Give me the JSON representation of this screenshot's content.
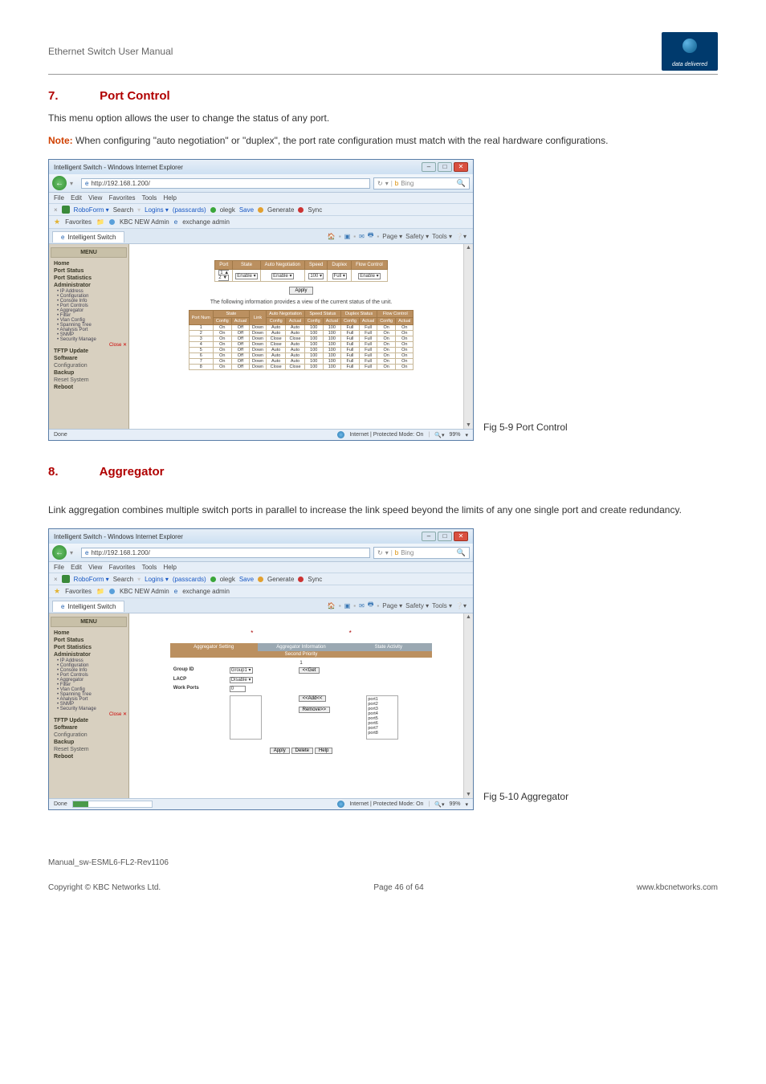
{
  "header": {
    "manual_title": "Ethernet Switch User Manual",
    "logo_text": "data delivered"
  },
  "section7": {
    "num": "7.",
    "title": "Port Control",
    "intro": "This menu option allows the user to change the status of any port.",
    "note_label": "Note:",
    "note_body": " When configuring \"auto negotiation\" or \"duplex\", the port rate configuration must match with the real hardware configurations.",
    "caption": "Fig 5-9 Port Control"
  },
  "section8": {
    "num": "8.",
    "title": "Aggregator",
    "intro": "Link aggregation combines multiple switch ports in parallel to increase the link speed beyond the limits of any one single port and create redundancy.",
    "caption": "Fig 5-10 Aggregator"
  },
  "browser": {
    "title": "Intelligent Switch - Windows Internet Explorer",
    "url": "http://192.168.1.200/",
    "search_placeholder": "Bing",
    "menus": {
      "file": "File",
      "edit": "Edit",
      "view": "View",
      "favorites": "Favorites",
      "tools": "Tools",
      "help": "Help"
    },
    "toolbar": {
      "roboform": "RoboForm ▾",
      "search_label": "Search",
      "logins": "Logins ▾",
      "passcards": "(passcards)",
      "olegk": "olegk",
      "save": "Save",
      "generate": "Generate",
      "sync": "Sync"
    },
    "favbar": {
      "favorites": "Favorites",
      "kbc": "KBC NEW Admin",
      "exchange": "exchange admin"
    },
    "tab": "Intelligent Switch",
    "tab_tools": {
      "home": "🏠",
      "feed": "▾",
      "mail": "▾",
      "print": "▾",
      "page": "Page ▾",
      "safety": "Safety ▾",
      "tools": "Tools ▾",
      "help": "❔▾"
    },
    "status_done": "Done",
    "status_mode": "Internet | Protected Mode: On",
    "status_zoom": "99%"
  },
  "menu_panel": {
    "header": "MENU",
    "items_top": [
      "Home",
      "Port Status",
      "Port Statistics",
      "Administrator"
    ],
    "admin_sub": [
      "IP Address",
      "Configuration",
      "Console Info",
      "Port Controls",
      "Aggregator",
      "Filter",
      "Vlan Config",
      "Spanning Tree",
      "Analysis Port",
      "SNMP",
      "Security Manage"
    ],
    "close": "Close ✕",
    "items_bottom": [
      "TFTP Update",
      "Software",
      "Configuration",
      "Backup",
      "Reset System",
      "Reboot"
    ]
  },
  "port_control_panel": {
    "top_headers": [
      "Port",
      "State",
      "Auto Negotiation",
      "Speed",
      "Duplex",
      "Flow Control"
    ],
    "top_row": {
      "ports": "1 ▲\n2 ▼",
      "state": "Enable ▾",
      "auto": "Enable ▾",
      "speed": "100 ▾",
      "duplex": "Full ▾",
      "flow": "Enable ▾"
    },
    "apply": "Apply",
    "info_line": "The following information provides a view of the current status of the unit.",
    "status_outer_headers": [
      "Port Num",
      "State",
      "Link",
      "Auto Negotiation",
      "Speed Status",
      "Duplex Status",
      "Flow Control"
    ],
    "status_sub_headers": [
      "Config",
      "Actual",
      "Config",
      "Actual",
      "Config",
      "Actual",
      "Config",
      "Actual",
      "Config",
      "Actual"
    ],
    "status_rows": [
      {
        "port": "1",
        "state_c": "On",
        "state_a": "Off",
        "link": "Down",
        "auto_c": "Auto",
        "auto_a": "Auto",
        "spd_c": "100",
        "spd_a": "100",
        "dup_c": "Full",
        "dup_a": "Full",
        "fl_c": "On",
        "fl_a": "On"
      },
      {
        "port": "2",
        "state_c": "On",
        "state_a": "Off",
        "link": "Down",
        "auto_c": "Auto",
        "auto_a": "Auto",
        "spd_c": "100",
        "spd_a": "100",
        "dup_c": "Full",
        "dup_a": "Full",
        "fl_c": "On",
        "fl_a": "On"
      },
      {
        "port": "3",
        "state_c": "On",
        "state_a": "Off",
        "link": "Down",
        "auto_c": "Close",
        "auto_a": "Close",
        "spd_c": "100",
        "spd_a": "100",
        "dup_c": "Full",
        "dup_a": "Full",
        "fl_c": "On",
        "fl_a": "On"
      },
      {
        "port": "4",
        "state_c": "On",
        "state_a": "Off",
        "link": "Down",
        "auto_c": "Close",
        "auto_a": "Auto",
        "spd_c": "100",
        "spd_a": "100",
        "dup_c": "Full",
        "dup_a": "Full",
        "fl_c": "On",
        "fl_a": "On"
      },
      {
        "port": "5",
        "state_c": "On",
        "state_a": "Off",
        "link": "Down",
        "auto_c": "Auto",
        "auto_a": "Auto",
        "spd_c": "100",
        "spd_a": "100",
        "dup_c": "Full",
        "dup_a": "Full",
        "fl_c": "On",
        "fl_a": "On"
      },
      {
        "port": "6",
        "state_c": "On",
        "state_a": "Off",
        "link": "Down",
        "auto_c": "Auto",
        "auto_a": "Auto",
        "spd_c": "100",
        "spd_a": "100",
        "dup_c": "Full",
        "dup_a": "Full",
        "fl_c": "On",
        "fl_a": "On"
      },
      {
        "port": "7",
        "state_c": "On",
        "state_a": "Off",
        "link": "Down",
        "auto_c": "Auto",
        "auto_a": "Auto",
        "spd_c": "100",
        "spd_a": "100",
        "dup_c": "Full",
        "dup_a": "Full",
        "fl_c": "On",
        "fl_a": "On"
      },
      {
        "port": "8",
        "state_c": "On",
        "state_a": "Off",
        "link": "Down",
        "auto_c": "Close",
        "auto_a": "Close",
        "spd_c": "100",
        "spd_a": "100",
        "dup_c": "Full",
        "dup_a": "Full",
        "fl_c": "On",
        "fl_a": "On"
      }
    ]
  },
  "aggregator_panel": {
    "tabs": [
      "Aggregator Setting",
      "Aggregator Information",
      "State Activity"
    ],
    "second_header": "Second Priority",
    "second_val": "1",
    "group_id_label": "Group ID",
    "group_id_val": "Group1 ▾",
    "get_btn": "<<Get",
    "lacp_label": "LACP",
    "lacp_val": "Disable ▾",
    "work_ports_label": "Work Ports",
    "work_ports_val": "0",
    "add_btn": "<<Add<<",
    "remove_btn": "Remove>>",
    "ports": [
      "port1",
      "port2",
      "port3",
      "port4",
      "port5",
      "port6",
      "port7",
      "port8"
    ],
    "bottom_buttons": [
      "Apply",
      "Delete",
      "Help"
    ]
  },
  "footer": {
    "filename": "Manual_sw-ESML6-FL2-Rev1106",
    "copyright": "Copyright © KBC Networks Ltd.",
    "page": "Page 46 of 64",
    "url": "www.kbcnetworks.com"
  }
}
